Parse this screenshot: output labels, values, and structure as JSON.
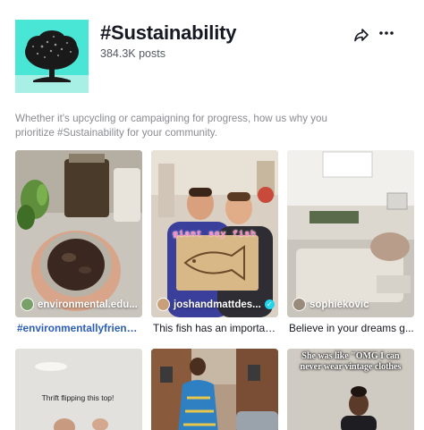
{
  "hashtag": {
    "title": "#Sustainability",
    "posts": "384.3K posts",
    "description": "Whether it's upcycling or campaigning for progress, how us why you prioritize #Sustainability for your community."
  },
  "actions": {
    "share_icon": "share-arrow-icon",
    "more_icon": "more-dots-icon"
  },
  "videos": [
    {
      "author": "environmental.edu...",
      "caption": "#environmentallyfriendly...",
      "caption_is_hashtag": true,
      "verified": false
    },
    {
      "author": "joshandmattdes...",
      "caption": "This fish has an importan...",
      "overlay": "giant soy fish",
      "verified": true
    },
    {
      "author": "sophiekovic",
      "caption": "Believe in your dreams g...",
      "verified": false
    },
    {
      "overlay": "Thrift flipping this top!"
    },
    {},
    {
      "overlay": "She was like \"OMG I can never wear vintage clothes"
    }
  ],
  "colors": {
    "cover_bg": "#49e6d6",
    "hashtag_link": "#2b5db9",
    "verified": "#20d5ec",
    "overlay_pink": "#ff7ab8"
  }
}
